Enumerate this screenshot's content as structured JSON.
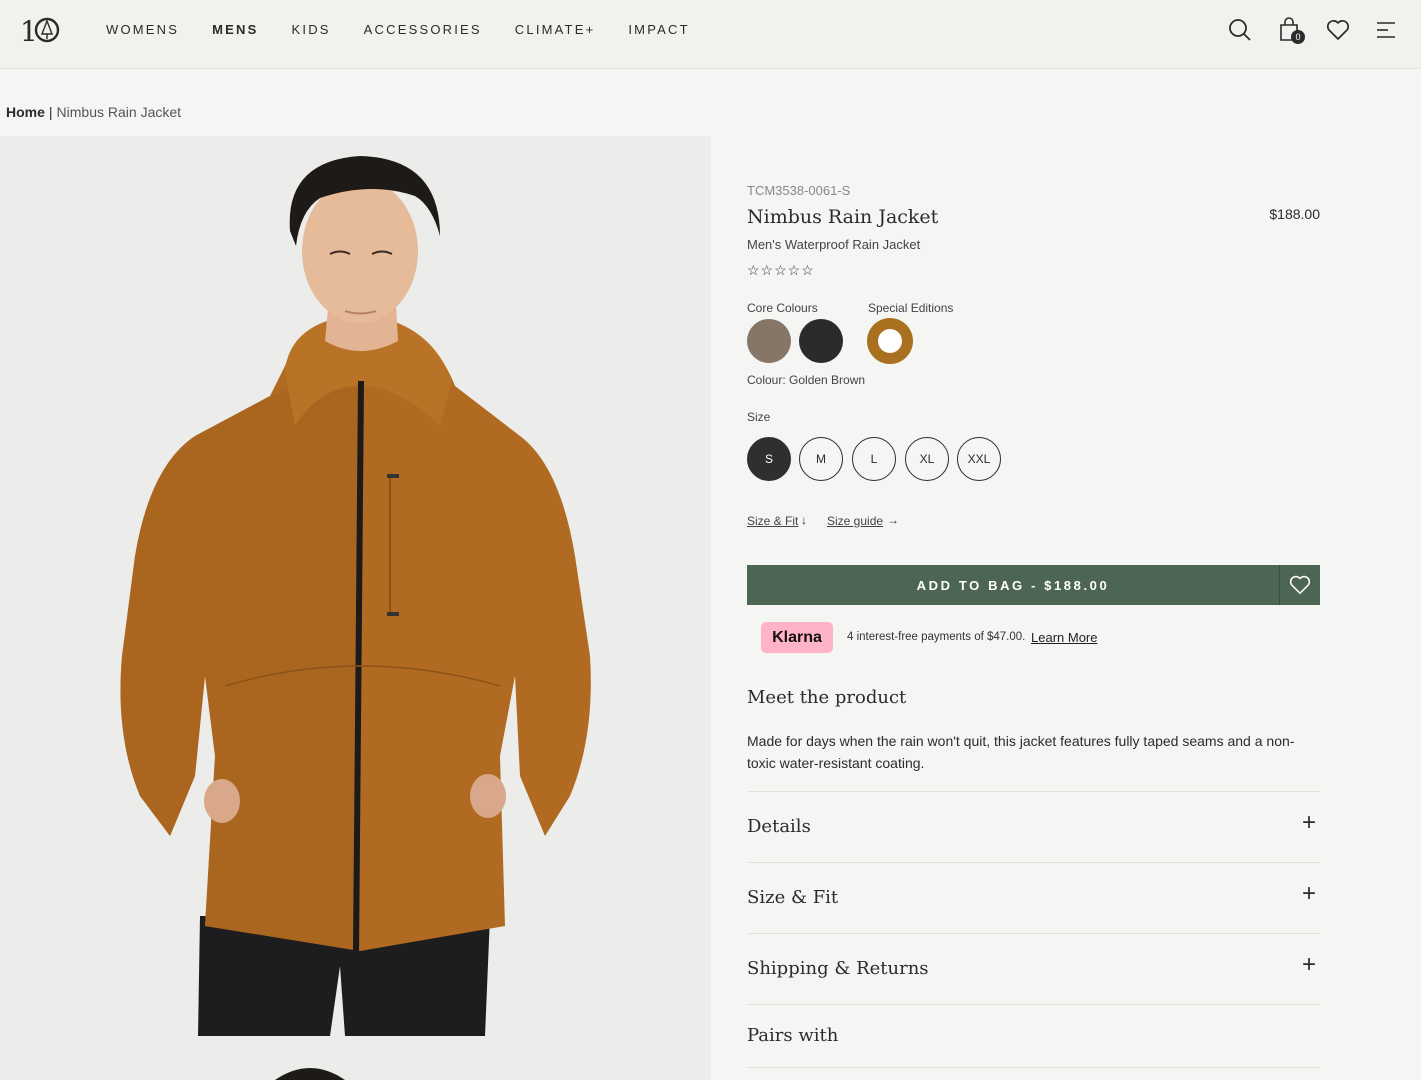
{
  "header": {
    "nav": [
      "WOMENS",
      "MENS",
      "KIDS",
      "ACCESSORIES",
      "CLIMATE+",
      "IMPACT"
    ],
    "active_nav": "MENS",
    "bag_count": "0"
  },
  "breadcrumb": {
    "home": "Home",
    "separator": "|",
    "current": "Nimbus Rain Jacket"
  },
  "product": {
    "sku": "TCM3538-0061-S",
    "title": "Nimbus Rain Jacket",
    "price": "$188.00",
    "subtitle": "Men's Waterproof Rain Jacket",
    "rating": "☆☆☆☆☆",
    "core_colours_label": "Core Colours",
    "special_editions_label": "Special Editions",
    "colours": [
      {
        "name": "Taupe",
        "hex": "#867667"
      },
      {
        "name": "Black",
        "hex": "#2a2b2d"
      },
      {
        "name": "Golden Brown",
        "hex": "#a8701f"
      }
    ],
    "colour_label": "Colour: Golden Brown",
    "size_label": "Size",
    "sizes": [
      "S",
      "M",
      "L",
      "XL",
      "XXL"
    ],
    "selected_size": "S",
    "size_fit_link": "Size & Fit",
    "size_guide_link": "Size guide",
    "add_to_bag": "ADD TO BAG - $188.00",
    "klarna_badge": "Klarna",
    "klarna_text": "4 interest-free payments of $47.00.",
    "klarna_learn": "Learn More",
    "meet_title": "Meet the product",
    "meet_text": "Made for days when the rain won't quit, this jacket features fully taped seams and a non-toxic water-resistant coating.",
    "accordions": [
      "Details",
      "Size & Fit",
      "Shipping & Returns",
      "Pairs with"
    ]
  },
  "colors": {
    "accent_green": "#4d6553",
    "jacket": "#b06a22",
    "klarna_pink": "#ffb3c7"
  }
}
